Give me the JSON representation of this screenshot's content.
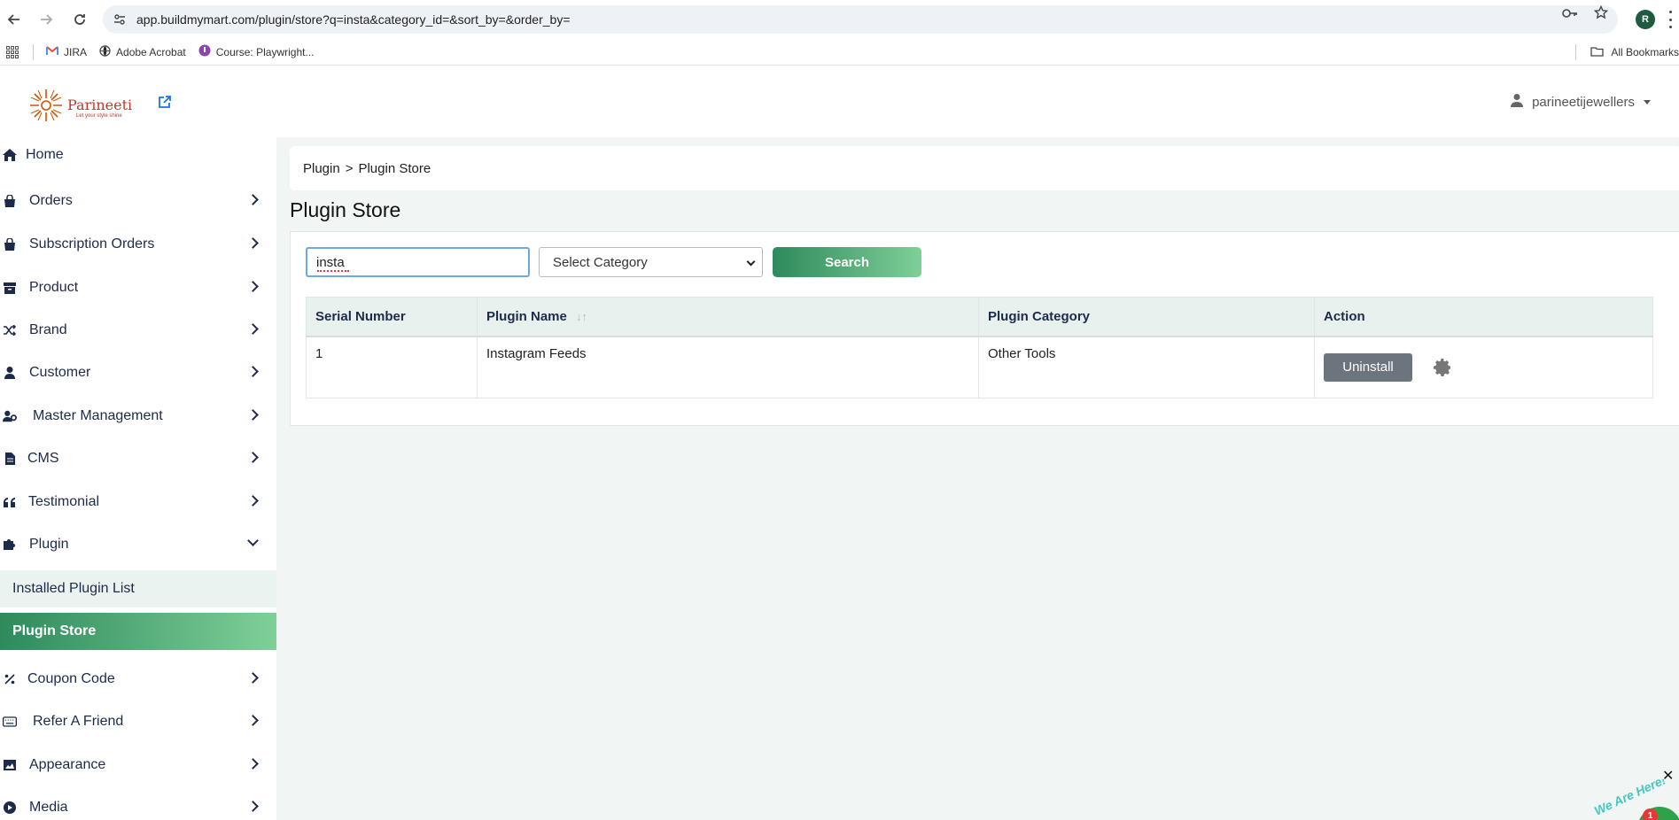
{
  "browser": {
    "url": "app.buildmymart.com/plugin/store?q=insta&category_id=&sort_by=&order_by=",
    "profile_initial": "R",
    "bookmarks": [
      {
        "label": "JIRA"
      },
      {
        "label": "Adobe Acrobat"
      },
      {
        "label": "Course: Playwright..."
      }
    ],
    "all_bookmarks": "All Bookmarks"
  },
  "header": {
    "logo_name": "Parineeti",
    "logo_tagline": "Let your style shine",
    "username": "parineetijewellers"
  },
  "sidebar": {
    "items": [
      {
        "label": "Home",
        "icon": "home-icon"
      },
      {
        "label": "Orders",
        "icon": "bag-icon"
      },
      {
        "label": "Subscription Orders",
        "icon": "bag-icon"
      },
      {
        "label": "Product",
        "icon": "box-icon"
      },
      {
        "label": "Brand",
        "icon": "shuffle-icon"
      },
      {
        "label": "Customer",
        "icon": "user-icon"
      },
      {
        "label": "Master Management",
        "icon": "user-gear-icon"
      },
      {
        "label": "CMS",
        "icon": "document-icon"
      },
      {
        "label": "Testimonial",
        "icon": "quote-icon"
      },
      {
        "label": "Plugin",
        "icon": "puzzle-icon"
      },
      {
        "label": "Coupon Code",
        "icon": "percent-icon"
      },
      {
        "label": "Refer A Friend",
        "icon": "keyboard-icon"
      },
      {
        "label": "Appearance",
        "icon": "image-icon"
      },
      {
        "label": "Media",
        "icon": "play-circle-icon"
      }
    ],
    "plugin_sub": [
      {
        "label": "Installed Plugin List"
      },
      {
        "label": "Plugin Store"
      }
    ]
  },
  "main": {
    "breadcrumb": [
      "Plugin",
      "Plugin Store"
    ],
    "breadcrumb_sep": ">",
    "title": "Plugin Store",
    "search": {
      "value": "insta",
      "category_placeholder": "Select Category",
      "button": "Search"
    },
    "table": {
      "headers": [
        "Serial Number",
        "Plugin Name",
        "Plugin Category",
        "Action"
      ],
      "rows": [
        {
          "serial": "1",
          "name": "Instagram Feeds",
          "category": "Other Tools",
          "action": "Uninstall"
        }
      ]
    }
  },
  "widget": {
    "text": "We Are Here!",
    "badge": "1"
  },
  "colors": {
    "accent_green": "#2e8a5c",
    "accent_green_light": "#7fcf98",
    "sidebar_text": "#1e2a4a",
    "button_gray": "#6c757d"
  }
}
